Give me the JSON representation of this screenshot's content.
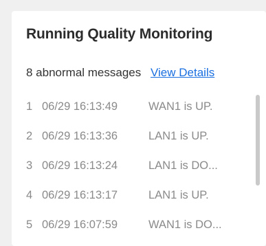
{
  "panel": {
    "title": "Running Quality Monitoring",
    "summary_count": "8 abnormal messages",
    "view_details_label": "View Details"
  },
  "log_items": [
    {
      "index": "1",
      "time": "06/29 16:13:49",
      "message": "WAN1 is UP."
    },
    {
      "index": "2",
      "time": "06/29 16:13:36",
      "message": "LAN1 is UP."
    },
    {
      "index": "3",
      "time": "06/29 16:13:24",
      "message": "LAN1 is DO..."
    },
    {
      "index": "4",
      "time": "06/29 16:13:17",
      "message": "LAN1 is UP."
    },
    {
      "index": "5",
      "time": "06/29 16:07:59",
      "message": "WAN1 is DO..."
    }
  ],
  "colors": {
    "link": "#1a6fe0",
    "title_text": "#2c2c2c",
    "log_text": "#8a8a8a",
    "card_background": "#ffffff",
    "page_background": "#f0f0f0"
  }
}
